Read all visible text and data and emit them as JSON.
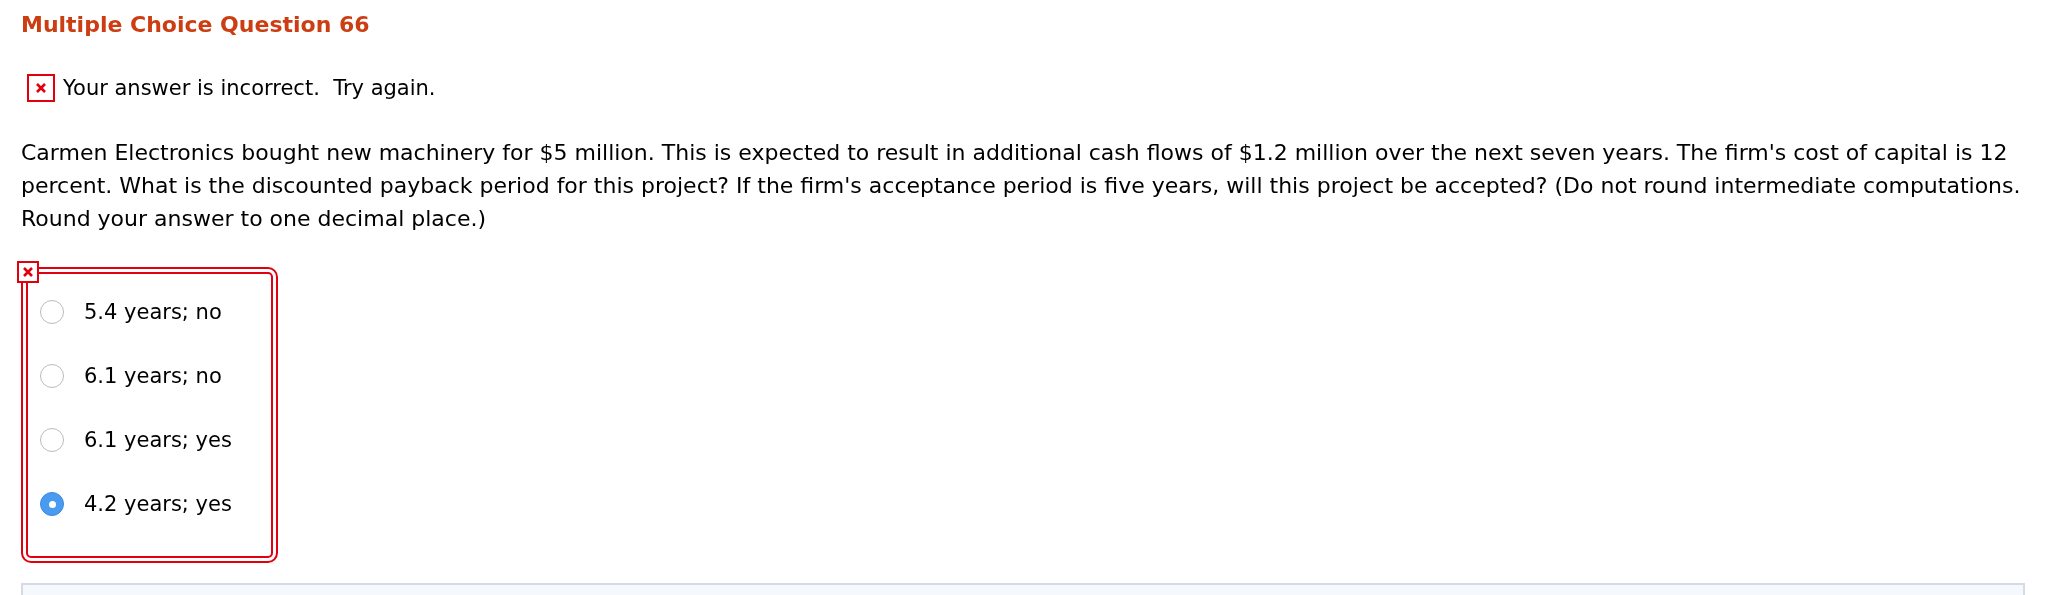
{
  "title": "Multiple Choice Question 66",
  "feedback": {
    "correct": false,
    "text": "Your answer is incorrect.  Try again."
  },
  "question": "Carmen Electronics bought new machinery for $5 million. This is expected to result in additional cash flows of $1.2 million over the next seven years. The firm's cost of capital is 12 percent. What is the discounted payback period for this project? If the firm's acceptance period is five years, will this project be accepted? (Do not round intermediate computations. Round your answer to one decimal place.)",
  "answer_correct": false,
  "options": [
    {
      "label": "5.4 years; no",
      "selected": false
    },
    {
      "label": "6.1 years; no",
      "selected": false
    },
    {
      "label": "6.1 years; yes",
      "selected": false
    },
    {
      "label": "4.2 years; yes",
      "selected": true
    }
  ]
}
